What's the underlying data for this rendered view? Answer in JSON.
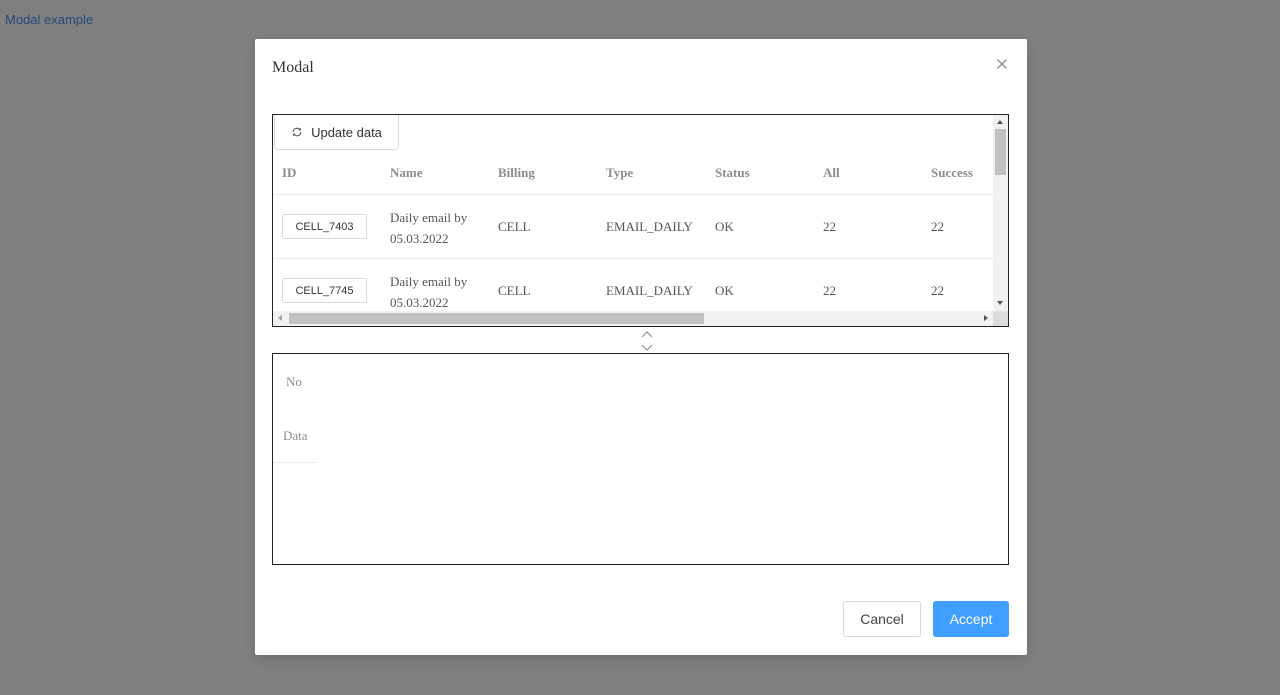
{
  "page": {
    "link_label": "Modal example"
  },
  "modal": {
    "title": "Modal",
    "close_icon": "close-icon",
    "toolbar": {
      "update_label": "Update data",
      "update_icon": "refresh-icon"
    },
    "table": {
      "columns": [
        "ID",
        "Name",
        "Billing",
        "Type",
        "Status",
        "All",
        "Success"
      ],
      "rows": [
        {
          "id": "CELL_7403",
          "name_line1": "Daily email by",
          "name_line2": "05.03.2022",
          "billing": "CELL",
          "type": "EMAIL_DAILY",
          "status": "OK",
          "all": "22",
          "success": "22"
        },
        {
          "id": "CELL_7745",
          "name_line1": "Daily email by",
          "name_line2": "05.03.2022",
          "billing": "CELL",
          "type": "EMAIL_DAILY",
          "status": "OK",
          "all": "22",
          "success": "22"
        }
      ]
    },
    "details": {
      "empty_line1": "No",
      "empty_line2": "Data"
    },
    "footer": {
      "cancel_label": "Cancel",
      "accept_label": "Accept"
    }
  },
  "colors": {
    "backdrop": "#808080",
    "link": "#24497a",
    "accent": "#409eff",
    "panel_border": "#222222"
  }
}
